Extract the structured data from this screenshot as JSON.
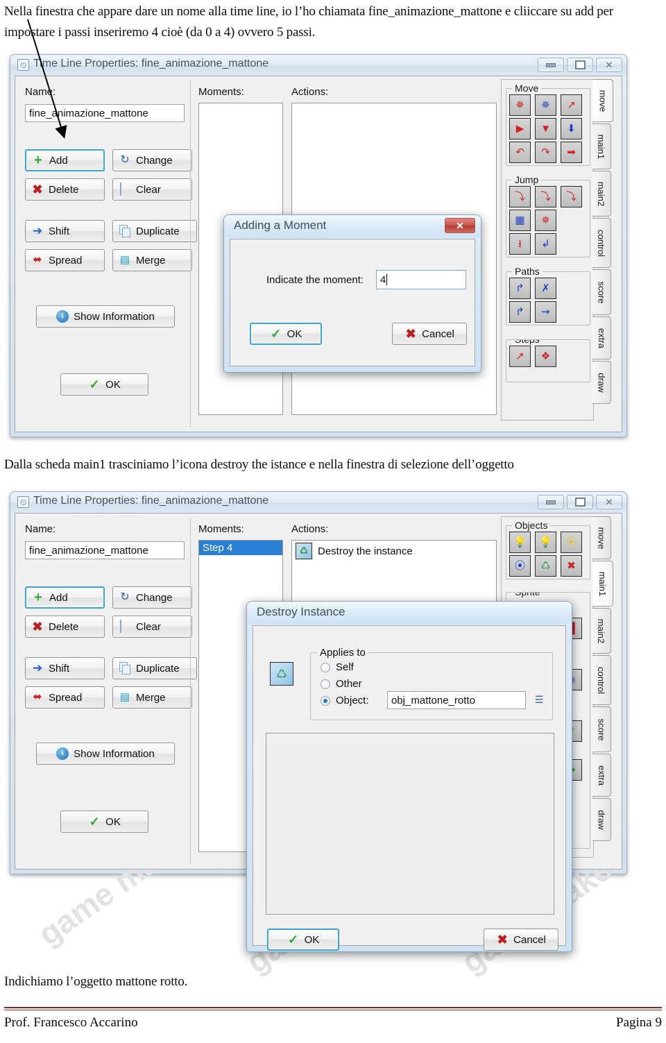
{
  "document": {
    "paragraph_top": "Nella finestra che appare dare un nome alla time line, io l’ho chiamata fine_animazione_mattone e cliiccare su add per impostare i passi inseriremo 4 cioè (da 0 a 4) ovvero 5 passi.",
    "paragraph_middle": "Dalla scheda main1 trasciniamo l’icona destroy the istance e nella finestra di selezione dell’oggetto",
    "paragraph_bottom": "Indichiamo l’oggetto mattone rotto.",
    "footer_author": "Prof. Francesco Accarino",
    "footer_page": "Pagina 9",
    "watermark": "game maker"
  },
  "colors": {
    "footer_rule": "#7b2c22",
    "selection_blue": "#2a7fd4",
    "focus_border": "#3ca4d8",
    "close_red": "#c8574c"
  },
  "window_one": {
    "title": "Time Line Properties: fine_animazione_mattone",
    "title_icon": "timeline-icon",
    "window_buttons": {
      "minimize": "minimize-icon",
      "maximize": "maximize-icon",
      "close": "close-icon"
    },
    "name_label": "Name:",
    "name_value": "fine_animazione_mattone",
    "moments_label": "Moments:",
    "actions_label": "Actions:",
    "moments": [],
    "actions": [],
    "buttons": [
      {
        "label": "Add",
        "icon": "plus-icon",
        "focused": true
      },
      {
        "label": "Change",
        "icon": "change-icon",
        "focused": false
      },
      {
        "label": "Delete",
        "icon": "delete-x-icon",
        "focused": false
      },
      {
        "label": "Clear",
        "icon": "page-icon",
        "focused": false
      },
      {
        "label": "Shift",
        "icon": "right-arrow-icon",
        "focused": false
      },
      {
        "label": "Duplicate",
        "icon": "duplicate-icon",
        "focused": false
      },
      {
        "label": "Spread",
        "icon": "spread-arrows-icon",
        "focused": false
      },
      {
        "label": "Merge",
        "icon": "merge-icon",
        "focused": false
      }
    ],
    "show_information_label": "Show Information",
    "show_information_icon": "info-icon",
    "ok_label": "OK",
    "ok_icon": "check-icon",
    "palette": {
      "groups": [
        {
          "title": "Move",
          "icons": [
            "move-fixed-icon",
            "move-free-icon",
            "move-towards-icon",
            "speed-horizontal-icon",
            "speed-vertical-icon",
            "set-gravity-icon",
            "reverse-horizontal-icon",
            "reverse-vertical-icon",
            "set-friction-icon"
          ]
        },
        {
          "title": "Jump",
          "icons": [
            "jump-position-icon",
            "jump-start-icon",
            "jump-random-icon",
            "align-to-grid-icon",
            "wrap-screen-icon",
            "move-to-contact-icon",
            "bounce-icon"
          ]
        },
        {
          "title": "Paths",
          "icons": [
            "set-path-icon",
            "end-path-icon",
            "path-position-icon",
            "path-speed-icon"
          ]
        },
        {
          "title": "Steps",
          "icons": [
            "step-towards-icon",
            "step-avoiding-icon"
          ]
        }
      ],
      "tabs": [
        "move",
        "main1",
        "main2",
        "control",
        "score",
        "extra",
        "draw"
      ],
      "active_tab": "move"
    }
  },
  "window_two": {
    "title": "Time Line Properties: fine_animazione_mattone",
    "title_icon": "timeline-icon",
    "window_buttons": {
      "minimize": "minimize-icon",
      "maximize": "maximize-icon",
      "close": "close-icon"
    },
    "name_label": "Name:",
    "name_value": "fine_animazione_mattone",
    "moments_label": "Moments:",
    "actions_label": "Actions:",
    "moments": [
      {
        "label": "Step 4",
        "selected": true
      }
    ],
    "actions": [
      {
        "label": "Destroy the instance",
        "icon": "destroy-instance-icon"
      }
    ],
    "buttons": [
      {
        "label": "Add",
        "icon": "plus-icon",
        "focused": true
      },
      {
        "label": "Change",
        "icon": "change-icon",
        "focused": false
      },
      {
        "label": "Delete",
        "icon": "delete-x-icon",
        "focused": false
      },
      {
        "label": "Clear",
        "icon": "page-icon",
        "focused": false
      },
      {
        "label": "Shift",
        "icon": "right-arrow-icon",
        "focused": false
      },
      {
        "label": "Duplicate",
        "icon": "duplicate-icon",
        "focused": false
      },
      {
        "label": "Spread",
        "icon": "spread-arrows-icon",
        "focused": false
      },
      {
        "label": "Merge",
        "icon": "merge-icon",
        "focused": false
      }
    ],
    "show_information_label": "Show Information",
    "show_information_icon": "info-icon",
    "ok_label": "OK",
    "ok_icon": "check-icon",
    "palette": {
      "groups": [
        {
          "title": "Objects",
          "icons": [
            "create-instance-icon",
            "create-moving-icon",
            "create-random-icon",
            "change-instance-icon",
            "destroy-instance-icon",
            "destroy-at-position-icon"
          ]
        },
        {
          "title": "Sprite",
          "icons": [
            "sprite-icon"
          ]
        }
      ],
      "tabs": [
        "move",
        "main1",
        "main2",
        "control",
        "score",
        "extra",
        "draw"
      ],
      "active_tab": "main1"
    }
  },
  "dialog_adding_moment": {
    "title": "Adding a Moment",
    "close_icon": "close-icon",
    "field_label": "Indicate the moment:",
    "field_value": "4",
    "ok_label": "OK",
    "ok_icon": "check-icon",
    "cancel_label": "Cancel",
    "cancel_icon": "cancel-x-icon"
  },
  "dialog_destroy_instance": {
    "title": "Destroy Instance",
    "action_icon": "destroy-instance-icon",
    "fieldset_title": "Applies to",
    "options": [
      {
        "label": "Self",
        "selected": false
      },
      {
        "label": "Other",
        "selected": false
      },
      {
        "label": "Object:",
        "selected": true
      }
    ],
    "object_value": "obj_mattone_rotto",
    "object_menu_icon": "object-picker-icon",
    "ok_label": "OK",
    "ok_icon": "check-icon",
    "cancel_label": "Cancel",
    "cancel_icon": "cancel-x-icon"
  }
}
